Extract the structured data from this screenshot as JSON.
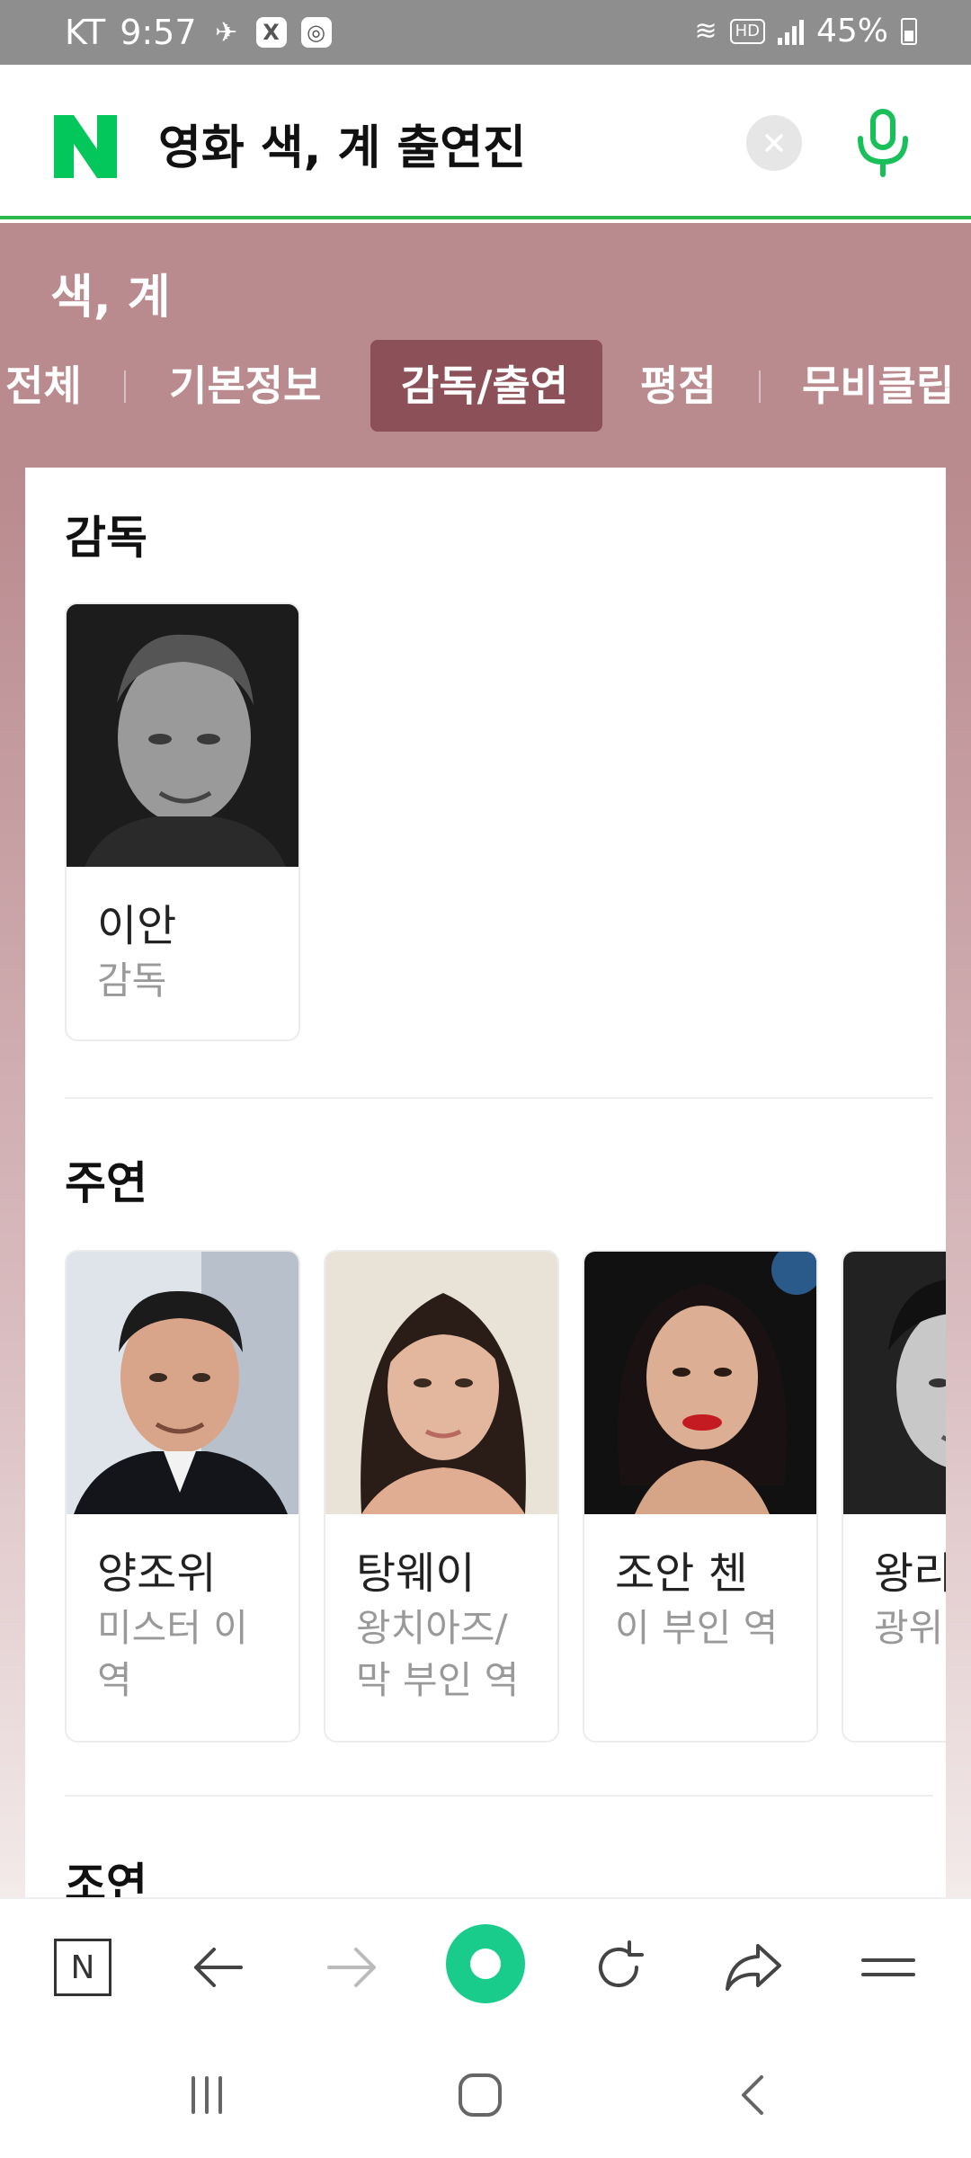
{
  "status_bar": {
    "carrier": "KT",
    "time": "9:57",
    "hd": "HD",
    "battery": "45%"
  },
  "search": {
    "query": "영화 색, 계 출연진"
  },
  "movie": {
    "title": "색, 계"
  },
  "tabs": [
    {
      "label": "전체",
      "active": false
    },
    {
      "label": "기본정보",
      "active": false
    },
    {
      "label": "감독/출연",
      "active": true
    },
    {
      "label": "평점",
      "active": false
    },
    {
      "label": "무비클립",
      "active": false
    }
  ],
  "sections": {
    "director": {
      "title": "감독",
      "people": [
        {
          "name": "이안",
          "role": "감독"
        }
      ]
    },
    "lead": {
      "title": "주연",
      "people": [
        {
          "name": "양조위",
          "role": "미스터 이\n역"
        },
        {
          "name": "탕웨이",
          "role": "왕치아즈/\n막 부인 역"
        },
        {
          "name": "조안 첸",
          "role": "이 부인 역"
        },
        {
          "name": "왕리홍",
          "role": "광위민"
        }
      ]
    },
    "supporting": {
      "title": "조연"
    }
  },
  "toolbar": {
    "naver_label": "N"
  },
  "colors": {
    "brand_green": "#03c75a",
    "band": "#b98a8e",
    "active_tab": "#8c5158",
    "home_button": "#19cc8c"
  },
  "icons": [
    "naver-logo-icon",
    "clear-icon",
    "mic-icon",
    "back-arrow-icon",
    "forward-arrow-icon",
    "reload-icon",
    "share-icon",
    "menu-icon",
    "recent-apps-icon",
    "home-icon",
    "system-back-icon"
  ]
}
